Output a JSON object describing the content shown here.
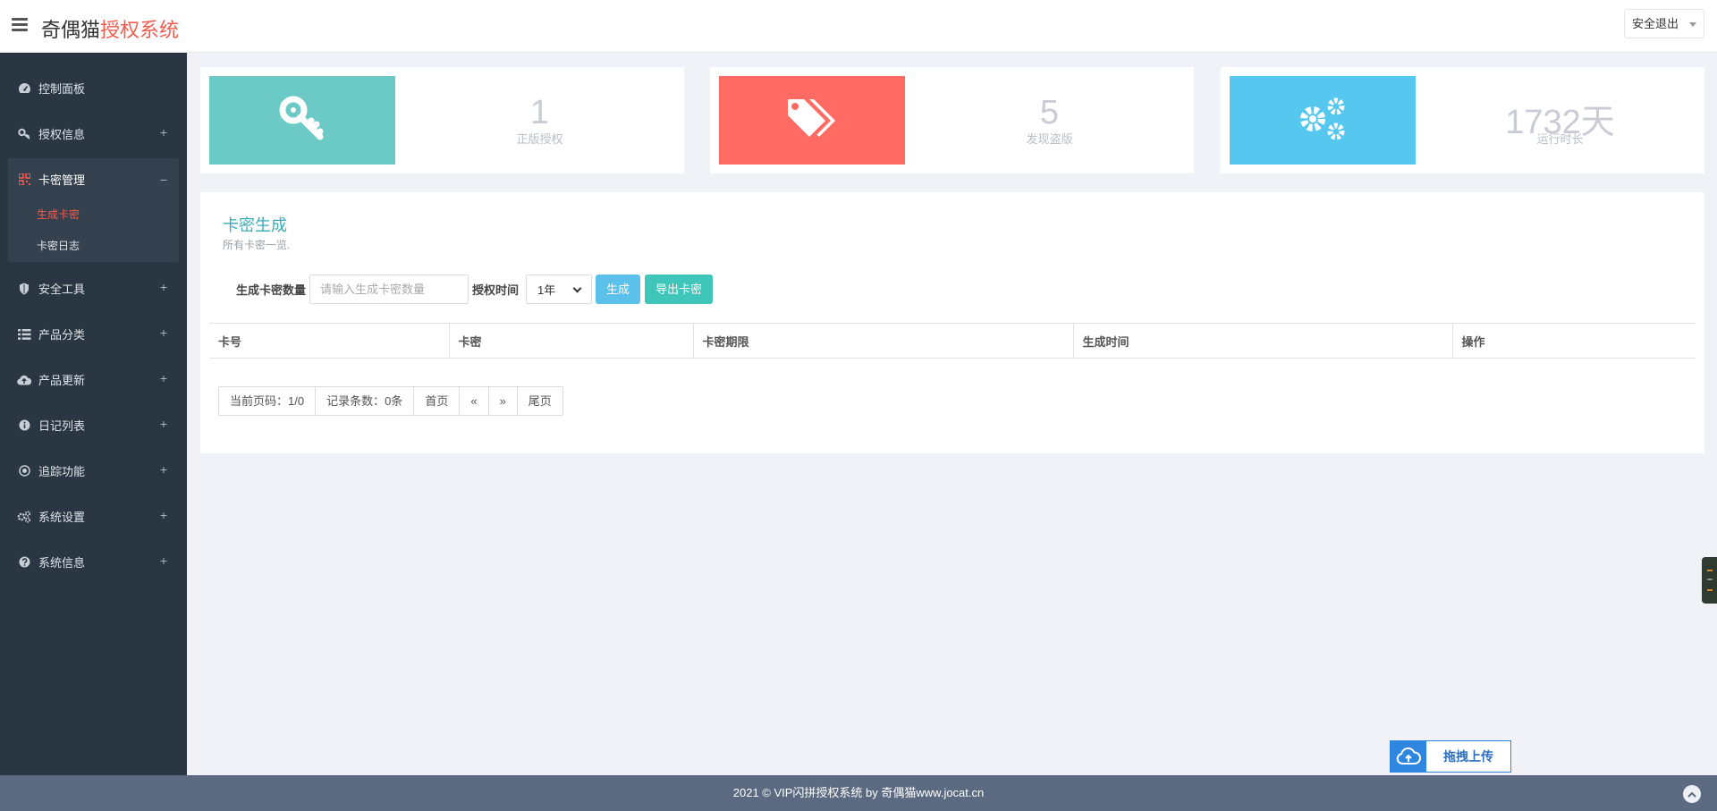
{
  "header": {
    "logo_main": "奇偶猫",
    "logo_accent": "授权系统",
    "logout_label": "安全退出"
  },
  "sidebar": {
    "items": [
      {
        "label": "控制面板",
        "icon": "dashboard-icon"
      },
      {
        "label": "授权信息",
        "icon": "key-icon",
        "expand": "+"
      },
      {
        "label": "卡密管理",
        "icon": "qrcode-icon",
        "expand": "−",
        "active": true,
        "children": [
          {
            "label": "生成卡密",
            "active": true
          },
          {
            "label": "卡密日志"
          }
        ]
      },
      {
        "label": "安全工具",
        "icon": "shield-icon",
        "expand": "+"
      },
      {
        "label": "产品分类",
        "icon": "list-icon",
        "expand": "+"
      },
      {
        "label": "产品更新",
        "icon": "cloud-upload-icon",
        "expand": "+"
      },
      {
        "label": "日记列表",
        "icon": "info-circle-icon",
        "expand": "+"
      },
      {
        "label": "追踪功能",
        "icon": "target-icon",
        "expand": "+"
      },
      {
        "label": "系统设置",
        "icon": "gears-icon",
        "expand": "+"
      },
      {
        "label": "系统信息",
        "icon": "question-circle-icon",
        "expand": "+"
      }
    ]
  },
  "stats": [
    {
      "value": "1",
      "label": "正版授权",
      "color": "#6ccac6",
      "icon": "key-icon"
    },
    {
      "value": "5",
      "label": "发现盗版",
      "color": "#ff6b62",
      "icon": "tags-icon"
    },
    {
      "value": "1732天",
      "label": "运行时长",
      "color": "#56c7ef",
      "icon": "gears-icon"
    }
  ],
  "panel": {
    "title": "卡密生成",
    "subtitle": "所有卡密一览.",
    "form": {
      "count_label": "生成卡密数量",
      "count_placeholder": "请输入生成卡密数量",
      "duration_label": "授权时间",
      "duration_value": "1年",
      "generate_label": "生成",
      "export_label": "导出卡密"
    },
    "table": {
      "columns": [
        "卡号",
        "卡密",
        "卡密期限",
        "生成时间",
        "操作"
      ]
    },
    "pager": {
      "current": "当前页码：1/0",
      "records": "记录条数：0条",
      "first": "首页",
      "prev": "«",
      "next": "»",
      "last": "尾页"
    }
  },
  "footer": {
    "text": "2021 © VIP闪拼授权系统 by 奇偶猫www.jocat.cn"
  },
  "upload_widget": {
    "label": "拖拽上传"
  },
  "colors": {
    "sidebar_bg": "#2b3643",
    "accent_red": "#f25c4d",
    "title_teal": "#3aa9b9",
    "btn_info": "#5bc0ea",
    "btn_success": "#3fc5b9",
    "footer_bg": "#5b6a80"
  }
}
